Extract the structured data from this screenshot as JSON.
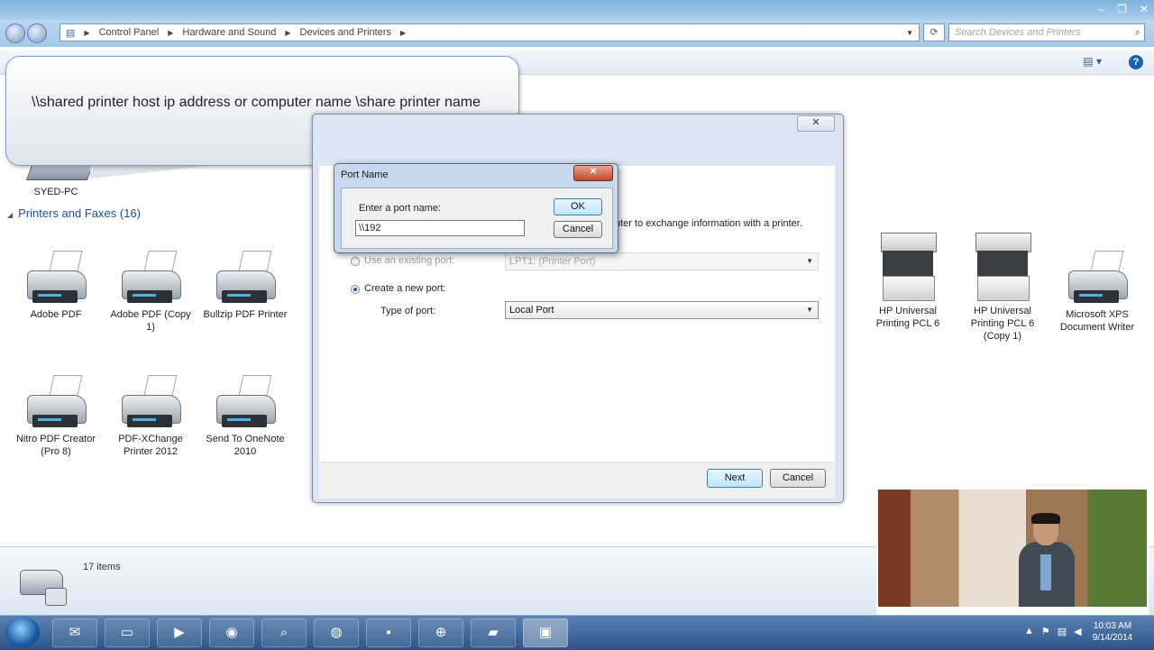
{
  "window": {
    "controls": [
      "–",
      "❐",
      "✕"
    ]
  },
  "address_bar": {
    "crumbs": [
      "Control Panel",
      "Hardware and Sound",
      "Devices and Printers"
    ],
    "search_placeholder": "Search Devices and Printers"
  },
  "callout": {
    "text": "\\\\shared printer host ip address or computer name \\share printer name"
  },
  "computer": {
    "label": "SYED-PC"
  },
  "group": {
    "title": "Printers and Faxes (16)"
  },
  "printers": [
    {
      "label": "Adobe PDF"
    },
    {
      "label": "Adobe PDF (Copy 1)"
    },
    {
      "label": "Bullzip PDF Printer"
    },
    {
      "label": "HP Universal Printing PCL 6"
    },
    {
      "label": "HP Universal Printing PCL 6 (Copy 1)"
    },
    {
      "label": "Microsoft XPS Document Writer"
    },
    {
      "label": "Nitro PDF Creator (Pro 8)"
    },
    {
      "label": "PDF-XChange Printer 2012"
    },
    {
      "label": "Send To OneNote 2010"
    }
  ],
  "status": {
    "count": "17 items"
  },
  "wizard": {
    "close_label": "✕",
    "info_text": "uter to exchange information with a printer.",
    "use_existing_label": "Use an existing port:",
    "use_existing_value": "LPT1: (Printer Port)",
    "create_new_label": "Create a new port:",
    "type_label": "Type of port:",
    "type_value": "Local Port",
    "next_label": "Next",
    "cancel_label": "Cancel"
  },
  "port_dialog": {
    "title": "Port Name",
    "close_label": "✕",
    "prompt": "Enter a port name:",
    "input_value": "\\\\192",
    "ok_label": "OK",
    "cancel_label": "Cancel"
  },
  "taskbar": {
    "time": "10:03 AM",
    "date": "9/14/2014"
  },
  "colors": {
    "accent": "#1e4f9a",
    "taskbar": "#2c5488"
  }
}
